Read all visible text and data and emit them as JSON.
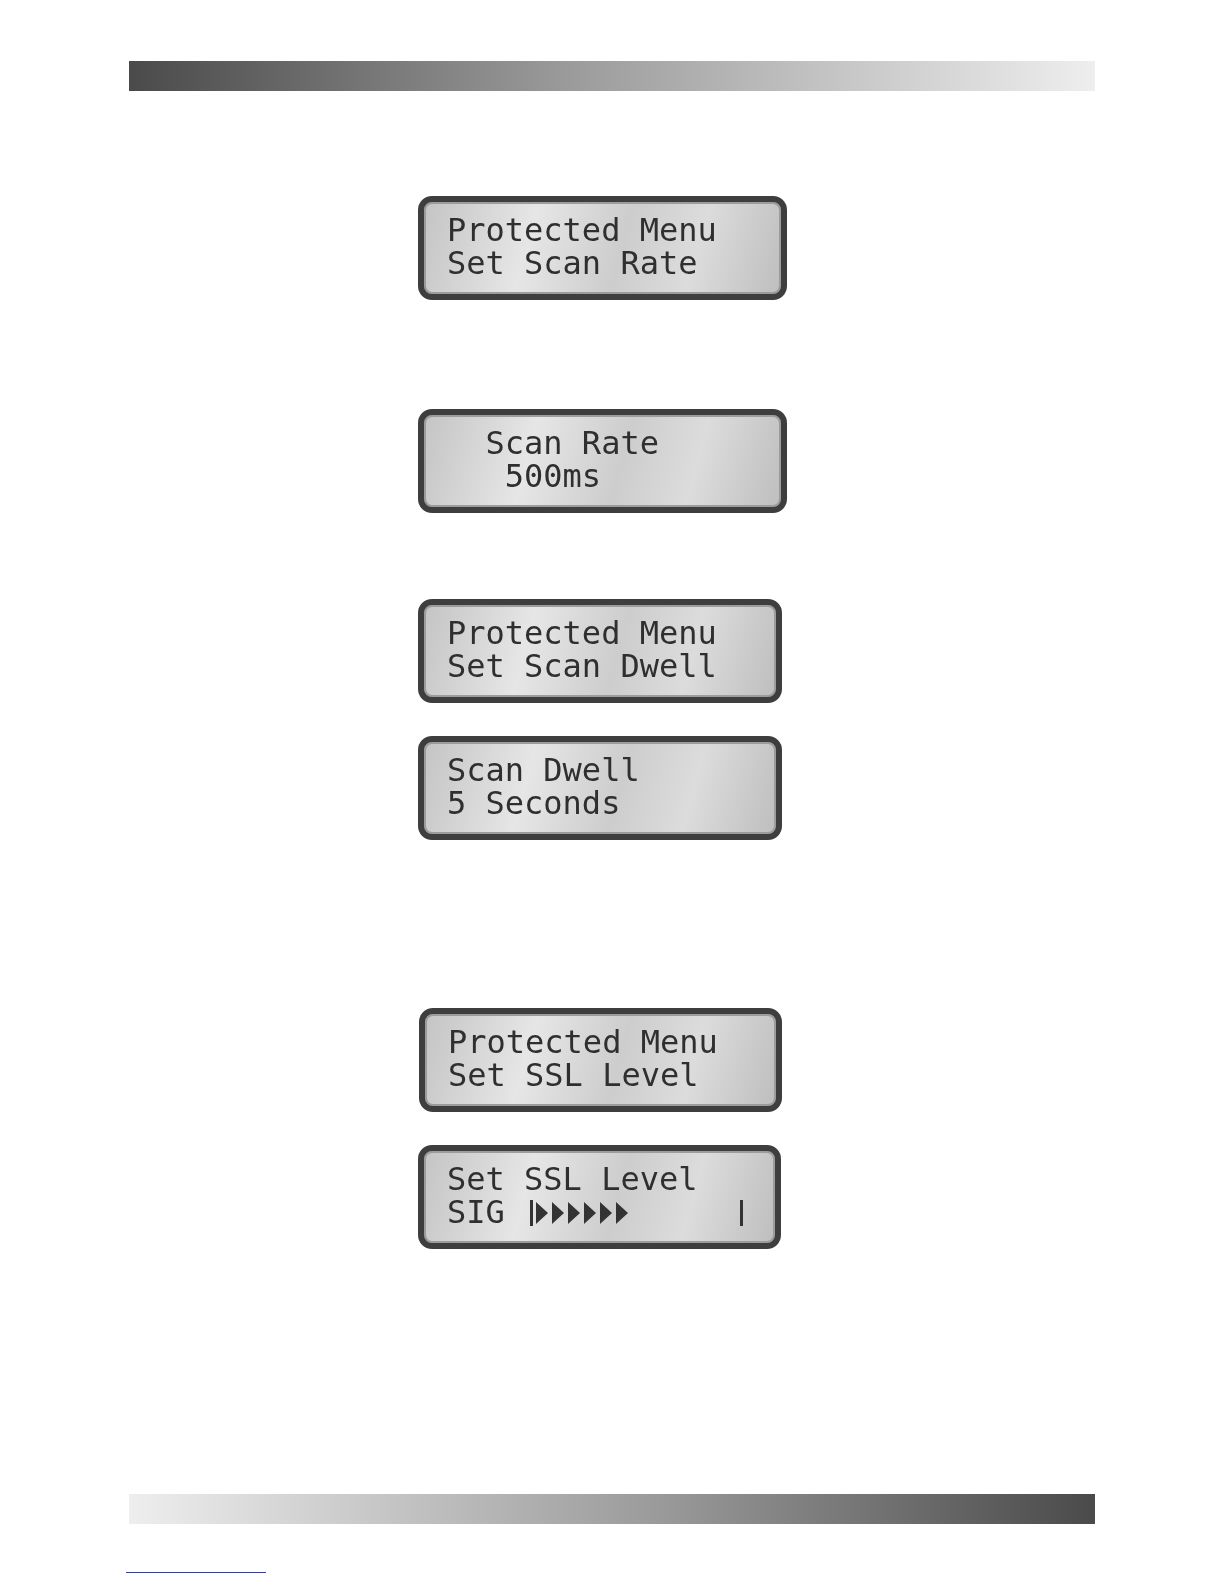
{
  "displays": [
    {
      "lines": [
        {
          "kind": "text",
          "text": "Protected Menu"
        },
        {
          "kind": "text",
          "text": "Set Scan Rate"
        }
      ]
    },
    {
      "lines": [
        {
          "kind": "text",
          "text": "  Scan Rate"
        },
        {
          "kind": "text",
          "text": "   500ms"
        }
      ]
    },
    {
      "lines": [
        {
          "kind": "text",
          "text": "Protected Menu"
        },
        {
          "kind": "text",
          "text": "Set Scan Dwell"
        }
      ]
    },
    {
      "lines": [
        {
          "kind": "text",
          "text": "Scan Dwell"
        },
        {
          "kind": "text",
          "text": "5 Seconds"
        }
      ]
    },
    {
      "lines": [
        {
          "kind": "text",
          "text": "Protected Menu"
        },
        {
          "kind": "text",
          "text": "Set SSL Level"
        }
      ]
    },
    {
      "lines": [
        {
          "kind": "text",
          "text": "Set SSL Level"
        },
        {
          "kind": "meter",
          "label": "SIG",
          "level": 0.47
        }
      ]
    }
  ]
}
